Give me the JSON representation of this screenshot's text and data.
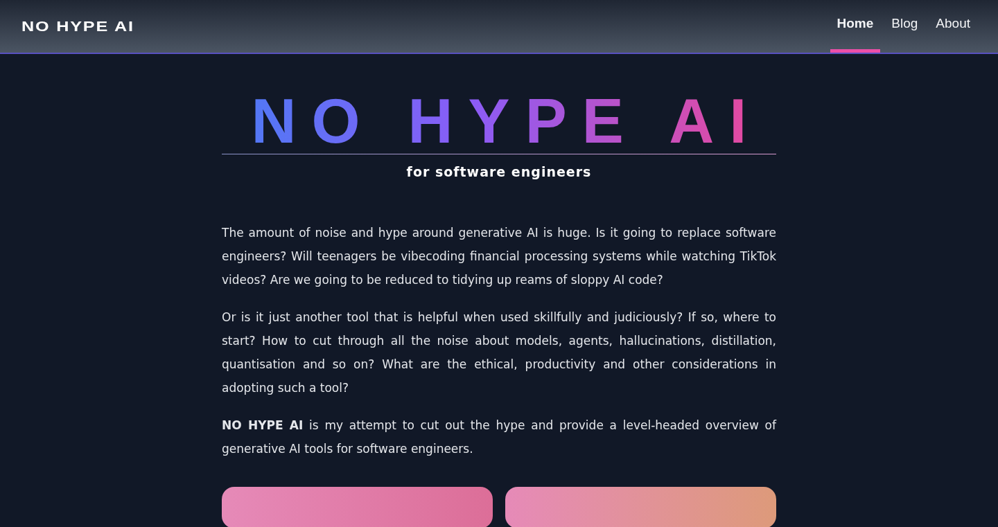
{
  "header": {
    "logo": "NO HYPE AI",
    "nav": [
      {
        "label": "Home",
        "selected": true
      },
      {
        "label": "Blog",
        "selected": false
      },
      {
        "label": "About",
        "selected": false
      }
    ]
  },
  "hero": {
    "title": "NO HYPE AI",
    "subtitle": "for software engineers"
  },
  "paragraphs": [
    "The amount of noise and hype around generative AI is huge. Is it going to replace software engineers? Will teenagers be vibecoding financial processing systems while watching TikTok videos? Are we going to be reduced to tidying up reams of sloppy AI code?",
    "Or is it just another tool that is helpful when used skillfully and judiciously? If so, where to start? How to cut through all the noise about models, agents, hallucinations, distillation, quantisation and so on? What are the ethical, productivity and other considerations in adopting such a tool?",
    "**NO HYPE AI** is my attempt to cut out the hype and provide a level-headed overview of generative AI tools for software engineers."
  ]
}
